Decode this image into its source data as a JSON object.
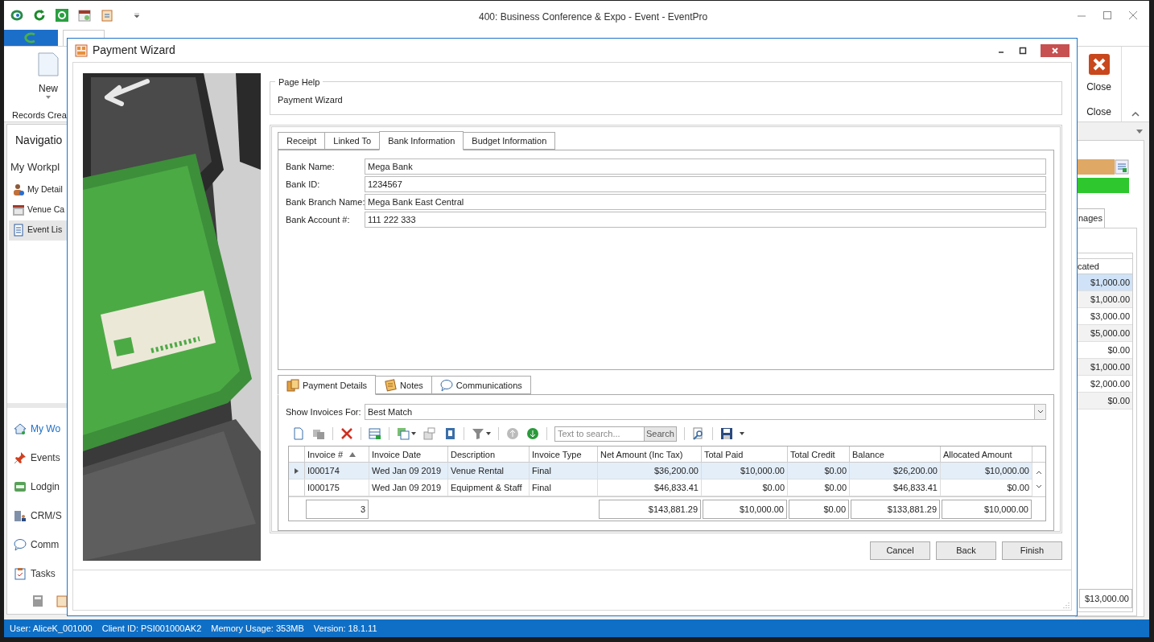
{
  "window": {
    "title": "400: Business Conference & Expo - Event - EventPro"
  },
  "ribbon": {
    "new_button": "New",
    "group_label": "Records Crea",
    "close_button": "Close",
    "close_group": "Close"
  },
  "navigation": {
    "title": "Navigatio",
    "section": "My Workpl",
    "items": [
      {
        "label": "My Detail",
        "selected": false,
        "kind": "person"
      },
      {
        "label": "Venue Ca",
        "selected": false,
        "kind": "calendar"
      },
      {
        "label": "Event Lis",
        "selected": true,
        "kind": "document"
      }
    ],
    "modules": [
      {
        "label": "My Wo",
        "selected": true,
        "kind": "home"
      },
      {
        "label": "Events",
        "selected": false,
        "kind": "pin"
      },
      {
        "label": "Lodgin",
        "selected": false,
        "kind": "bed"
      },
      {
        "label": "CRM/S",
        "selected": false,
        "kind": "building"
      },
      {
        "label": "Comm",
        "selected": false,
        "kind": "bubble"
      },
      {
        "label": "Tasks",
        "selected": false,
        "kind": "clipboard"
      }
    ]
  },
  "background_panel": {
    "tab": "nages",
    "column": "cated",
    "rows": [
      {
        "value": "$1,000.00",
        "selected": true
      },
      {
        "value": "$1,000.00",
        "selected": false
      },
      {
        "value": "$3,000.00",
        "selected": false
      },
      {
        "value": "$5,000.00",
        "selected": false
      },
      {
        "value": "$0.00",
        "selected": false
      },
      {
        "value": "$1,000.00",
        "selected": false
      },
      {
        "value": "$2,000.00",
        "selected": false
      },
      {
        "value": "$0.00",
        "selected": false
      }
    ],
    "total": "$13,000.00"
  },
  "dialog": {
    "title": "Payment Wizard",
    "page_help": {
      "legend": "Page Help",
      "text": "Payment Wizard"
    },
    "tabs": [
      {
        "label": "Receipt",
        "selected": false
      },
      {
        "label": "Linked To",
        "selected": false
      },
      {
        "label": "Bank Information",
        "selected": true
      },
      {
        "label": "Budget Information",
        "selected": false
      }
    ],
    "fields": [
      {
        "label": "Bank Name:",
        "value": "Mega Bank"
      },
      {
        "label": "Bank ID:",
        "value": "1234567"
      },
      {
        "label": "Bank Branch Name:",
        "value": "Mega Bank East Central"
      },
      {
        "label": "Bank Account #:",
        "value": "111 222 333"
      }
    ],
    "detail_tabs": [
      {
        "label": "Payment Details",
        "selected": true,
        "kind": "payment"
      },
      {
        "label": "Notes",
        "selected": false,
        "kind": "notes"
      },
      {
        "label": "Communications",
        "selected": false,
        "kind": "bubble"
      }
    ],
    "filter": {
      "label": "Show Invoices For:",
      "value": "Best Match"
    },
    "search": {
      "placeholder": "Text to search...",
      "button": "Search"
    },
    "grid": {
      "columns": [
        {
          "label": "Invoice #",
          "sorted": true
        },
        {
          "label": "Invoice Date",
          "sorted": false
        },
        {
          "label": "Description",
          "sorted": false
        },
        {
          "label": "Invoice Type",
          "sorted": false
        },
        {
          "label": "Net Amount (Inc Tax)",
          "sorted": false
        },
        {
          "label": "Total Paid",
          "sorted": false
        },
        {
          "label": "Total Credit",
          "sorted": false
        },
        {
          "label": "Balance",
          "sorted": false
        },
        {
          "label": "Allocated Amount",
          "sorted": false
        }
      ],
      "rows": [
        {
          "selected": true,
          "cells": [
            "I000174",
            "Wed Jan 09 2019",
            "Venue Rental",
            "Final",
            "$36,200.00",
            "$10,000.00",
            "$0.00",
            "$26,200.00",
            "$10,000.00"
          ]
        },
        {
          "selected": false,
          "cells": [
            "I000175",
            "Wed Jan 09 2019",
            "Equipment & Staff",
            "Final",
            "$46,833.41",
            "$0.00",
            "$0.00",
            "$46,833.41",
            "$0.00"
          ]
        }
      ],
      "summary": {
        "invoice_count": "3",
        "net_amount": "$143,881.29",
        "total_paid": "$10,000.00",
        "total_credit": "$0.00",
        "balance": "$133,881.29",
        "allocated_amount": "$10,000.00"
      }
    },
    "buttons": [
      "Cancel",
      "Back",
      "Finish"
    ]
  },
  "status_bar": [
    "User: AliceK_001000",
    "Client ID: PSI001000AK2",
    "Memory Usage: 353MB",
    "Version: 18.1.11"
  ]
}
